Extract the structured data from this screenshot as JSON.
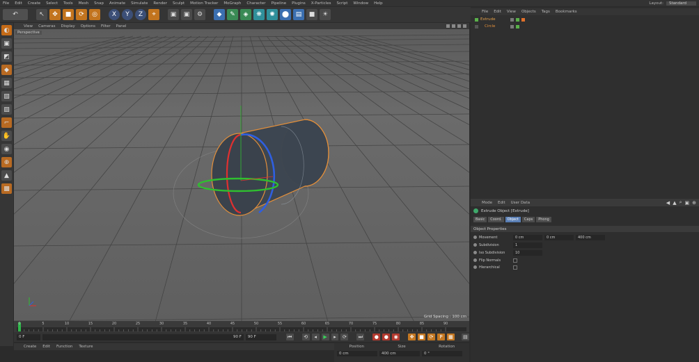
{
  "menubar": {
    "items": [
      "File",
      "Edit",
      "Create",
      "Select",
      "Tools",
      "Mesh",
      "Snap",
      "Animate",
      "Simulate",
      "Render",
      "Sculpt",
      "Motion Tracker",
      "MoGraph",
      "Character",
      "Pipeline",
      "Plugins",
      "X-Particles",
      "Script",
      "Window",
      "Help"
    ],
    "layout_label": "Layout:",
    "layout_value": "Standard"
  },
  "toolbar": {
    "undo_icon": "↶",
    "axis_x": "X",
    "axis_y": "Y",
    "axis_z": "Z"
  },
  "viewport": {
    "menu": [
      "View",
      "Cameras",
      "Display",
      "Options",
      "Filter",
      "Panel"
    ],
    "camera_label": "Perspective",
    "grid_spacing": "Grid Spacing : 100 cm"
  },
  "timeline": {
    "ticks": [
      "0",
      "5",
      "10",
      "15",
      "20",
      "25",
      "30",
      "35",
      "40",
      "45",
      "50",
      "55",
      "60",
      "65",
      "70",
      "75",
      "80",
      "85",
      "90"
    ],
    "current_frame": 0,
    "start_field": "0 F",
    "range_field": "90 F",
    "end_field": "90 F"
  },
  "material": {
    "menu": [
      "Create",
      "Edit",
      "Function",
      "Texture"
    ]
  },
  "coordinates": {
    "headers": [
      "Position",
      "Size",
      "Rotation"
    ],
    "x_pos": "0 cm",
    "x_size": "400 cm",
    "x_rot": "0 °"
  },
  "objects": {
    "menu": [
      "File",
      "Edit",
      "View",
      "Objects",
      "Tags",
      "Bookmarks"
    ],
    "rows": [
      {
        "name": "Extrude"
      },
      {
        "name": "Circle"
      }
    ]
  },
  "attributes": {
    "menu": [
      "Mode",
      "Edit",
      "User Data"
    ],
    "title": "Extrude Object [Extrude]",
    "tabs": [
      "Basic",
      "Coord.",
      "Object",
      "Caps",
      "Phong"
    ],
    "active_tab": "Object",
    "section": "Object Properties",
    "props": {
      "movement_label": "Movement",
      "movement_x": "0 cm",
      "movement_y": "0 cm",
      "movement_z": "400 cm",
      "subdivision_label": "Subdivision",
      "subdivision_value": "1",
      "iso_label": "Iso Subdivision",
      "iso_value": "10",
      "flip_label": "Flip Normals",
      "hier_label": "Hierarchical"
    }
  },
  "colors": {
    "accent_orange": "#e38f3a",
    "active_tab": "#5a7fb5",
    "axis_x": "#e03030",
    "axis_y": "#2fc02f",
    "axis_z": "#2f5fe0"
  }
}
